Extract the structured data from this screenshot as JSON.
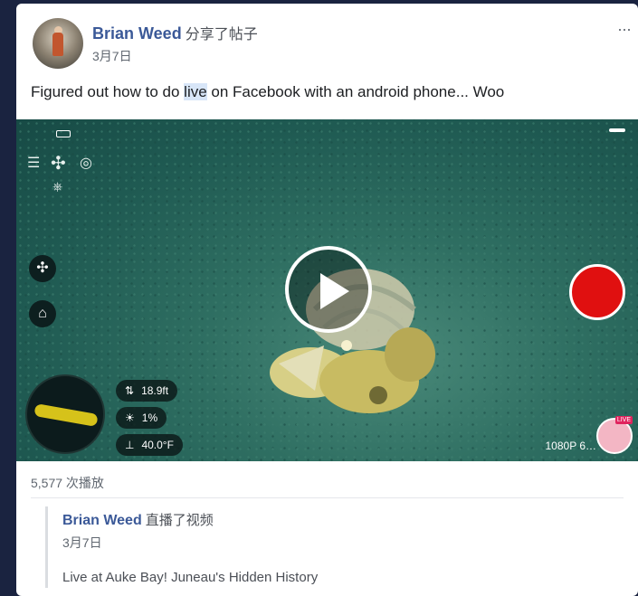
{
  "post": {
    "author": "Brian Weed",
    "action": "分享了帖子",
    "date": "3月7日",
    "more_icon": "···",
    "caption_before": "Figured out how to do ",
    "caption_highlight": "live",
    "caption_after": " on Facebook with an android phone... Woo"
  },
  "video": {
    "overlay": {
      "stats": [
        {
          "icon": "depth-icon",
          "glyph": "⇅",
          "value": "18.9ft"
        },
        {
          "icon": "light-icon",
          "glyph": "☀",
          "value": "1%"
        },
        {
          "icon": "temperature-icon",
          "glyph": "⊥",
          "value": "40.0°F"
        }
      ],
      "quality": "1080P 6…"
    },
    "colors": {
      "record": "#e01010",
      "water": "#2f6f62"
    }
  },
  "views": "5,577 次播放",
  "shared_post": {
    "author": "Brian Weed",
    "action": "直播了视频",
    "date": "3月7日",
    "title": "Live at Auke Bay! Juneau's Hidden History"
  }
}
